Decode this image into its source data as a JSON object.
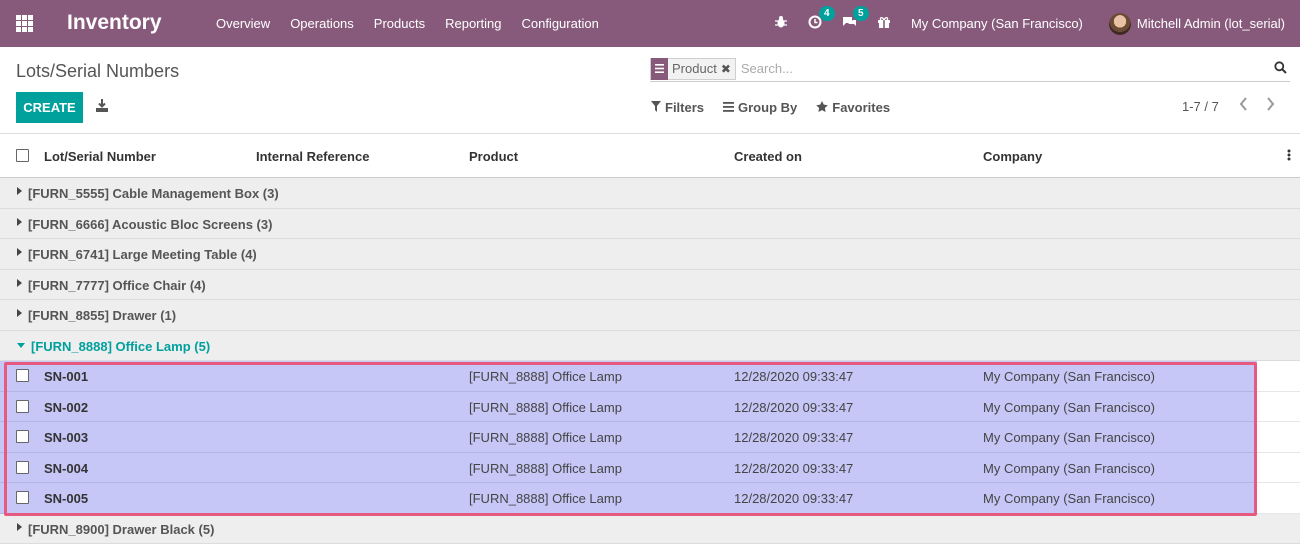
{
  "navbar": {
    "app_title": "Inventory",
    "menu": [
      "Overview",
      "Operations",
      "Products",
      "Reporting",
      "Configuration"
    ],
    "activity_count": "4",
    "messages_count": "5",
    "company": "My Company (San Francisco)",
    "user": "Mitchell Admin (lot_serial)",
    "accent": "#875a7b"
  },
  "control_panel": {
    "breadcrumb": "Lots/Serial Numbers",
    "facet_label": "Product",
    "search_placeholder": "Search...",
    "create_label": "CREATE",
    "filters_label": "Filters",
    "groupby_label": "Group By",
    "favorites_label": "Favorites",
    "pager": "1-7 / 7",
    "primary_color": "#00a09d"
  },
  "list": {
    "columns": [
      "Lot/Serial Number",
      "Internal Reference",
      "Product",
      "Created on",
      "Company"
    ],
    "groups_before": [
      "[FURN_5555] Cable Management Box (3)",
      "[FURN_6666] Acoustic Bloc Screens (3)",
      "[FURN_6741] Large Meeting Table (4)",
      "[FURN_7777] Office Chair (4)",
      "[FURN_8855] Drawer (1)"
    ],
    "open_group": "[FURN_8888] Office Lamp (5)",
    "rows": [
      {
        "lot": "SN-001",
        "product": "[FURN_8888] Office Lamp",
        "created": "12/28/2020 09:33:47",
        "company": "My Company (San Francisco)"
      },
      {
        "lot": "SN-002",
        "product": "[FURN_8888] Office Lamp",
        "created": "12/28/2020 09:33:47",
        "company": "My Company (San Francisco)"
      },
      {
        "lot": "SN-003",
        "product": "[FURN_8888] Office Lamp",
        "created": "12/28/2020 09:33:47",
        "company": "My Company (San Francisco)"
      },
      {
        "lot": "SN-004",
        "product": "[FURN_8888] Office Lamp",
        "created": "12/28/2020 09:33:47",
        "company": "My Company (San Francisco)"
      },
      {
        "lot": "SN-005",
        "product": "[FURN_8888] Office Lamp",
        "created": "12/28/2020 09:33:47",
        "company": "My Company (San Francisco)"
      }
    ],
    "groups_after": [
      "[FURN_8900] Drawer Black (5)"
    ],
    "highlight_color": "#e55a7e",
    "row_selected_color": "#c6c6f7"
  }
}
